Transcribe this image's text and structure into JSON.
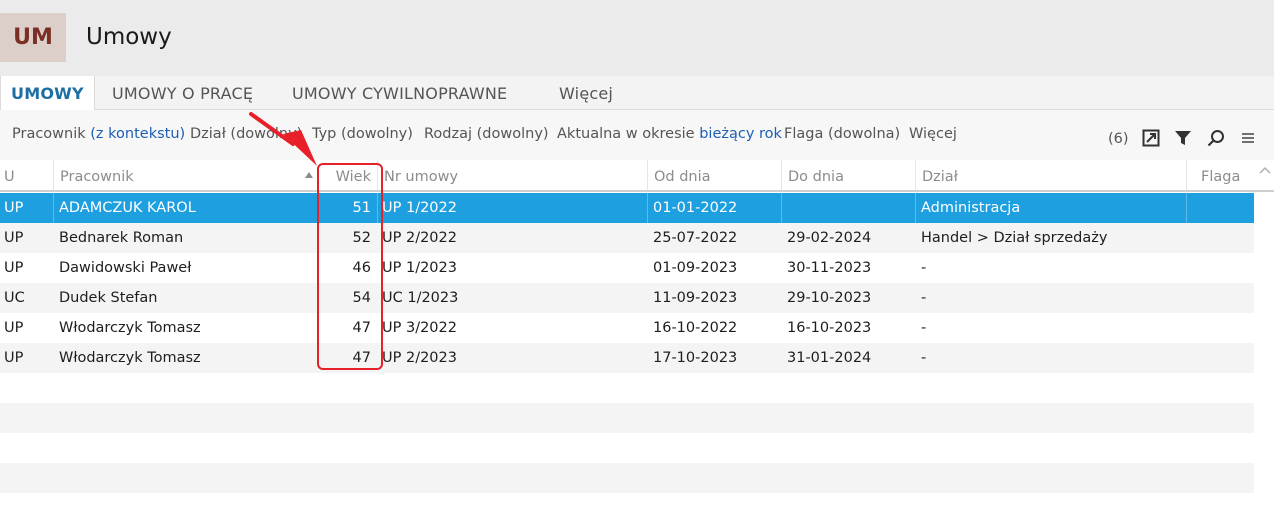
{
  "app": {
    "badge": "UM",
    "title": "Umowy"
  },
  "tabs": [
    {
      "label": "UMOWY"
    },
    {
      "label": "UMOWY O PRACĘ"
    },
    {
      "label": "UMOWY CYWILNOPRAWNE"
    },
    {
      "label": "Więcej"
    }
  ],
  "filters": {
    "pracownik_label": "Pracownik",
    "pracownik_value": "(z kontekstu)",
    "dzial": "Dział (dowolny)",
    "typ": "Typ (dowolny)",
    "rodzaj": "Rodzaj (dowolny)",
    "aktualna_label": "Aktualna w okresie",
    "aktualna_value": "bieżący rok",
    "flaga": "Flaga (dowolna)",
    "wiecej": "Więcej",
    "count": "(6)"
  },
  "toolbar_icons": [
    "export-icon",
    "filter-icon",
    "search-icon",
    "menu-icon"
  ],
  "columns": {
    "u": "U",
    "pracownik": "Pracownik",
    "wiek": "Wiek",
    "nr_umowy": "Nr umowy",
    "od_dnia": "Od dnia",
    "do_dnia": "Do dnia",
    "dzial": "Dział",
    "flaga": "Flaga"
  },
  "rows": [
    {
      "u": "UP",
      "pracownik": "ADAMCZUK KAROL",
      "wiek": "51",
      "nr_umowy": "UP 1/2022",
      "od_dnia": "01-01-2022",
      "do_dnia": "",
      "dzial": "Administracja",
      "flaga": ""
    },
    {
      "u": "UP",
      "pracownik": "Bednarek Roman",
      "wiek": "52",
      "nr_umowy": "UP 2/2022",
      "od_dnia": "25-07-2022",
      "do_dnia": "29-02-2024",
      "dzial": "Handel > Dział sprzedaży",
      "flaga": ""
    },
    {
      "u": "UP",
      "pracownik": "Dawidowski Paweł",
      "wiek": "46",
      "nr_umowy": "UP 1/2023",
      "od_dnia": "01-09-2023",
      "do_dnia": "30-11-2023",
      "dzial": "-",
      "flaga": ""
    },
    {
      "u": "UC",
      "pracownik": "Dudek Stefan",
      "wiek": "54",
      "nr_umowy": "UC 1/2023",
      "od_dnia": "11-09-2023",
      "do_dnia": "29-10-2023",
      "dzial": "-",
      "flaga": ""
    },
    {
      "u": "UP",
      "pracownik": "Włodarczyk Tomasz",
      "wiek": "47",
      "nr_umowy": "UP 3/2022",
      "od_dnia": "16-10-2022",
      "do_dnia": "16-10-2023",
      "dzial": "-",
      "flaga": ""
    },
    {
      "u": "UP",
      "pracownik": "Włodarczyk Tomasz",
      "wiek": "47",
      "nr_umowy": "UP 2/2023",
      "od_dnia": "17-10-2023",
      "do_dnia": "31-01-2024",
      "dzial": "-",
      "flaga": ""
    }
  ],
  "selected_row": 0,
  "colors": {
    "accent": "#1c6ea4",
    "selection": "#1e9fe0",
    "annotation": "#e8202a",
    "badge_bg": "#dccfca",
    "badge_text": "#7a2f24"
  }
}
